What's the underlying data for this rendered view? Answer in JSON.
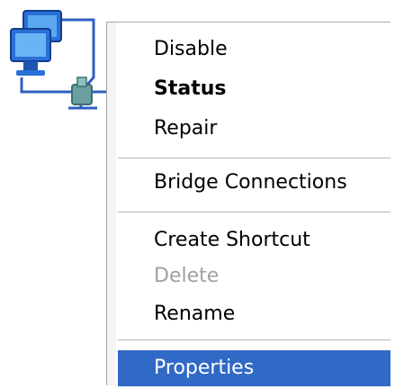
{
  "desktop_icon": {
    "icon": "network-connection-icon"
  },
  "context_menu": {
    "items": [
      {
        "label": "Disable",
        "style": "normal"
      },
      {
        "label": "Status",
        "style": "bold"
      },
      {
        "label": "Repair",
        "style": "normal"
      },
      {
        "label": "Bridge Connections",
        "style": "normal"
      },
      {
        "label": "Create Shortcut",
        "style": "normal"
      },
      {
        "label": "Delete",
        "style": "disabled"
      },
      {
        "label": "Rename",
        "style": "normal"
      },
      {
        "label": "Properties",
        "style": "selected"
      }
    ],
    "colors": {
      "highlight": "#3169c6",
      "highlight_text": "#ffffff",
      "disabled_text": "#a0a0a0",
      "separator": "#b8b8b8"
    }
  }
}
